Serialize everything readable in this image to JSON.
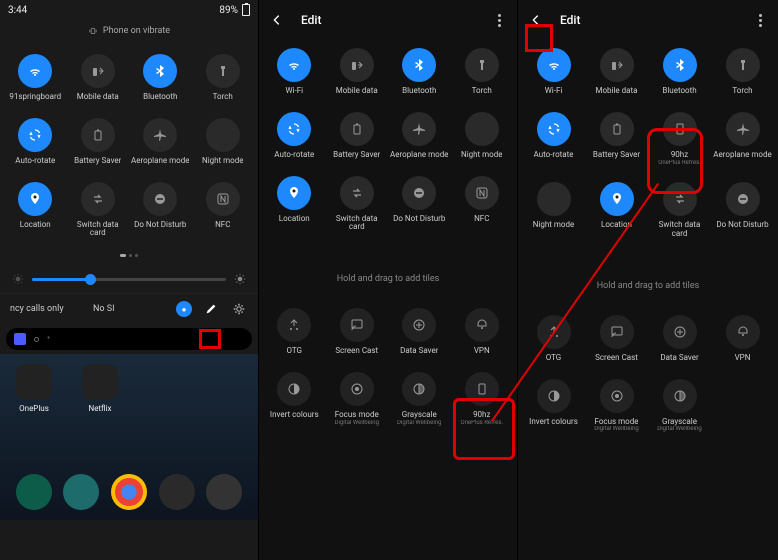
{
  "status": {
    "time": "3:44",
    "battery_pct": "89%"
  },
  "vibrate_banner": "Phone on vibrate",
  "panel1": {
    "tiles": [
      {
        "label": "91springboard",
        "icon": "wifi",
        "state": "on"
      },
      {
        "label": "Mobile data",
        "icon": "data",
        "state": "off"
      },
      {
        "label": "Bluetooth",
        "icon": "bluetooth",
        "state": "on"
      },
      {
        "label": "Torch",
        "icon": "torch",
        "state": "off"
      },
      {
        "label": "Auto-rotate",
        "icon": "rotate",
        "state": "on"
      },
      {
        "label": "Battery Saver",
        "icon": "battery",
        "state": "off"
      },
      {
        "label": "Aeroplane mode",
        "icon": "plane",
        "state": "off"
      },
      {
        "label": "Night mode",
        "icon": "moon",
        "state": "off"
      },
      {
        "label": "Location",
        "icon": "location",
        "state": "on"
      },
      {
        "label": "Switch data card",
        "icon": "swap",
        "state": "off"
      },
      {
        "label": "Do Not Disturb",
        "icon": "dnd",
        "state": "off"
      },
      {
        "label": "NFC",
        "icon": "nfc",
        "state": "off"
      }
    ],
    "sim1": "ncy calls only",
    "sim2": "No SI",
    "home_apps": [
      {
        "label": "OnePlus"
      },
      {
        "label": "Netflix"
      }
    ]
  },
  "edit": {
    "title": "Edit",
    "avail_hint": "Hold and drag to add tiles"
  },
  "panel2": {
    "active": [
      {
        "label": "Wi-Fi",
        "icon": "wifi",
        "state": "on"
      },
      {
        "label": "Mobile data",
        "icon": "data",
        "state": "off"
      },
      {
        "label": "Bluetooth",
        "icon": "bluetooth",
        "state": "on"
      },
      {
        "label": "Torch",
        "icon": "torch",
        "state": "off"
      },
      {
        "label": "Auto-rotate",
        "icon": "rotate",
        "state": "on"
      },
      {
        "label": "Battery Saver",
        "icon": "battery",
        "state": "off"
      },
      {
        "label": "Aeroplane mode",
        "icon": "plane",
        "state": "off"
      },
      {
        "label": "Night mode",
        "icon": "moon",
        "state": "off"
      },
      {
        "label": "Location",
        "icon": "location",
        "state": "on"
      },
      {
        "label": "Switch data card",
        "icon": "swap",
        "state": "off"
      },
      {
        "label": "Do Not Disturb",
        "icon": "dnd",
        "state": "off"
      },
      {
        "label": "NFC",
        "icon": "nfc",
        "state": "off"
      }
    ],
    "avail": [
      {
        "label": "OTG",
        "icon": "otg"
      },
      {
        "label": "Screen Cast",
        "icon": "cast"
      },
      {
        "label": "Data Saver",
        "icon": "datasaver"
      },
      {
        "label": "VPN",
        "icon": "vpn"
      },
      {
        "label": "Invert colours",
        "icon": "invert"
      },
      {
        "label": "Focus mode",
        "sublabel": "Digital Wellbeing",
        "icon": "focus"
      },
      {
        "label": "Grayscale",
        "sublabel": "Digital Wellbeing",
        "icon": "grayscale"
      },
      {
        "label": "90hz",
        "sublabel": "OnePlus Refres.",
        "icon": "screen"
      }
    ]
  },
  "panel3": {
    "active": [
      {
        "label": "Wi-Fi",
        "icon": "wifi",
        "state": "on"
      },
      {
        "label": "Mobile data",
        "icon": "data",
        "state": "off"
      },
      {
        "label": "Bluetooth",
        "icon": "bluetooth",
        "state": "on"
      },
      {
        "label": "Torch",
        "icon": "torch",
        "state": "off"
      },
      {
        "label": "Auto-rotate",
        "icon": "rotate",
        "state": "on"
      },
      {
        "label": "Battery Saver",
        "icon": "battery",
        "state": "off"
      },
      {
        "label": "90hz",
        "sublabel": "OnePlus Refres.",
        "icon": "screen",
        "state": "off"
      },
      {
        "label": "Aeroplane mode",
        "icon": "plane",
        "state": "off"
      },
      {
        "label": "Night mode",
        "icon": "moon",
        "state": "off"
      },
      {
        "label": "Location",
        "icon": "location",
        "state": "on"
      },
      {
        "label": "Switch data card",
        "icon": "swap",
        "state": "off"
      },
      {
        "label": "Do Not Disturb",
        "icon": "dnd",
        "state": "off"
      }
    ],
    "avail": [
      {
        "label": "OTG",
        "icon": "otg"
      },
      {
        "label": "Screen Cast",
        "icon": "cast"
      },
      {
        "label": "Data Saver",
        "icon": "datasaver"
      },
      {
        "label": "VPN",
        "icon": "vpn"
      },
      {
        "label": "Invert colours",
        "icon": "invert"
      },
      {
        "label": "Focus mode",
        "sublabel": "Digital Wellbeing",
        "icon": "focus"
      },
      {
        "label": "Grayscale",
        "sublabel": "Digital Wellbeing",
        "icon": "grayscale"
      }
    ]
  },
  "colors": {
    "accent": "#1e88ff",
    "highlight": "#e00000"
  }
}
